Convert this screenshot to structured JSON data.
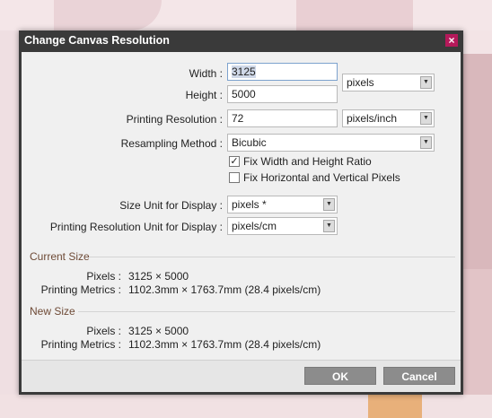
{
  "dialog": {
    "title": "Change Canvas Resolution",
    "close_glyph": "×"
  },
  "size": {
    "width_label": "Width :",
    "width_value": "3125",
    "height_label": "Height :",
    "height_value": "5000",
    "unit_value": "pixels"
  },
  "printing": {
    "label": "Printing Resolution :",
    "value": "72",
    "unit_value": "pixels/inch"
  },
  "resampling": {
    "label": "Resampling Method :",
    "value": "Bicubic"
  },
  "options": {
    "fix_ratio_label": "Fix Width and Height Ratio",
    "fix_ratio_checked": "✓",
    "fix_pixels_label": "Fix Horizontal and Vertical Pixels"
  },
  "display": {
    "size_unit_label": "Size Unit for Display :",
    "size_unit_value": "pixels *",
    "res_unit_label": "Printing Resolution Unit for Display :",
    "res_unit_value": "pixels/cm"
  },
  "current_size": {
    "title": "Current Size",
    "pixels_label": "Pixels :",
    "pixels_value": "3125 × 5000",
    "metrics_label": "Printing Metrics :",
    "metrics_value": "1102.3mm × 1763.7mm (28.4 pixels/cm)"
  },
  "new_size": {
    "title": "New Size",
    "pixels_label": "Pixels :",
    "pixels_value": "3125 × 5000",
    "metrics_label": "Printing Metrics :",
    "metrics_value": "1102.3mm × 1763.7mm (28.4 pixels/cm)"
  },
  "buttons": {
    "ok": "OK",
    "cancel": "Cancel"
  },
  "icons": {
    "dropdown": "dropdown-arrow-icon",
    "close": "close-icon",
    "check": "checkmark-icon"
  },
  "colors": {
    "titlebar": "#3a3a3a",
    "close": "#b5195a",
    "section_title": "#6e4a36",
    "button": "#8c8c8c"
  }
}
